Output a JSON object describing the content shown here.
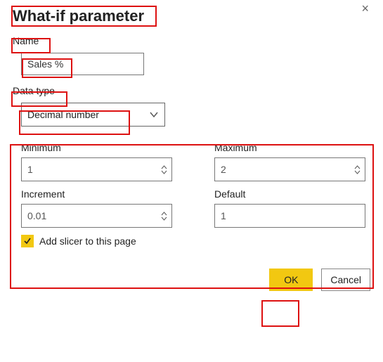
{
  "dialog": {
    "title": "What-if parameter",
    "close_icon": "×"
  },
  "name": {
    "label": "Name",
    "value": "Sales %"
  },
  "datatype": {
    "label": "Data type",
    "selected": "Decimal number"
  },
  "minimum": {
    "label": "Minimum",
    "value": "1"
  },
  "maximum": {
    "label": "Maximum",
    "value": "2"
  },
  "increment": {
    "label": "Increment",
    "value": "0.01"
  },
  "default": {
    "label": "Default",
    "value": "1"
  },
  "slicer": {
    "label": "Add slicer to this page",
    "checked": true
  },
  "buttons": {
    "ok": "OK",
    "cancel": "Cancel"
  }
}
